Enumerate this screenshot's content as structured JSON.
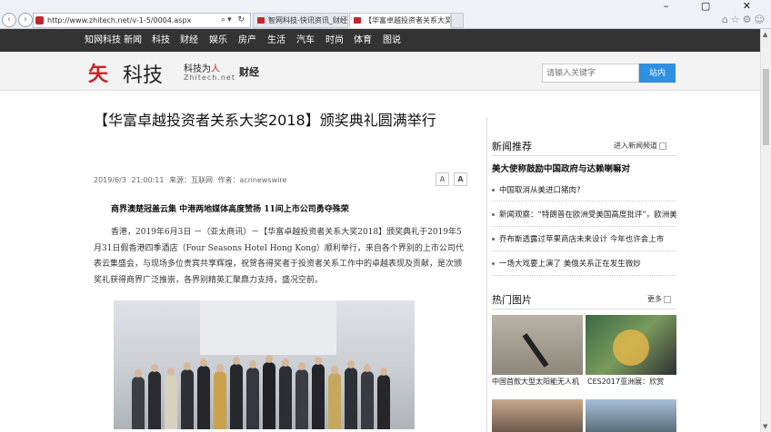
{
  "browser": {
    "url": "http://www.zhitech.net/v-1-5/0004.aspx",
    "tabs": [
      {
        "label": "智网科技-快讯资讯_财经..."
      },
      {
        "label": "【华富卓越投资者关系大奖..."
      }
    ],
    "window_controls": "–  ▢  ✕"
  },
  "site_nav": [
    "知网科技",
    "新闻",
    "科技",
    "财经",
    "娱乐",
    "房产",
    "生活",
    "汽车",
    "时尚",
    "体育",
    "图说"
  ],
  "header": {
    "logo_mark": "矢",
    "logo_text": "科技",
    "slogan_a": "科技为",
    "slogan_b": "人",
    "logo_sub": "Zhitech.net",
    "channel": "财经",
    "search_placeholder": "请输入关键字",
    "search_button": "站内"
  },
  "article": {
    "title": "【华富卓越投资者关系大奖2018】颁奖典礼圆满举行",
    "date": "2019/6/3 21:00:11",
    "source": "来源：互联网",
    "author": "作者：acnnewswire",
    "font_small": "A",
    "font_large": "A",
    "lead": "商界澳楚冠盖云集 中港两地媒体高度赞扬 11间上市公司勇夺殊荣",
    "paragraph": "香港，2019年6月3日 －（亚太商讯）－【华富卓越投资者关系大奖2018】颁奖典礼于2019年5月31日假香港四季酒店（Four Seasons Hotel Hong Kong）顺利举行，来自各个界别的上市公司代表云集盛会，与现场多位贵宾共享辉煌，祝贺各得奖者于投资者关系工作中的卓越表现及贡献，是次颁奖礼获得商界广泛推崇，各界别精英汇聚鼎力支持，盛况空前。"
  },
  "sidebar": {
    "news_heading": "新闻推荐",
    "news_more": "进入新闻频道",
    "headline": "美大使称鼓励中国政府与达赖喇嘛对",
    "news_items": [
      "中国取消从美进口猪肉?",
      "新闻观察：“特朗普在欧洲受美国高度批评”，欧洲美国",
      "乔布斯透露过苹果商店未来设计 今年也许会上市",
      "一场大戏要上演了 美俄关系正在发生微妙"
    ],
    "photo_heading": "热门图片",
    "photo_more": "更多",
    "photos": [
      {
        "caption": "中国首款大型太阳能无人机"
      },
      {
        "caption": "CES2017亚洲展：欣赏"
      }
    ]
  }
}
